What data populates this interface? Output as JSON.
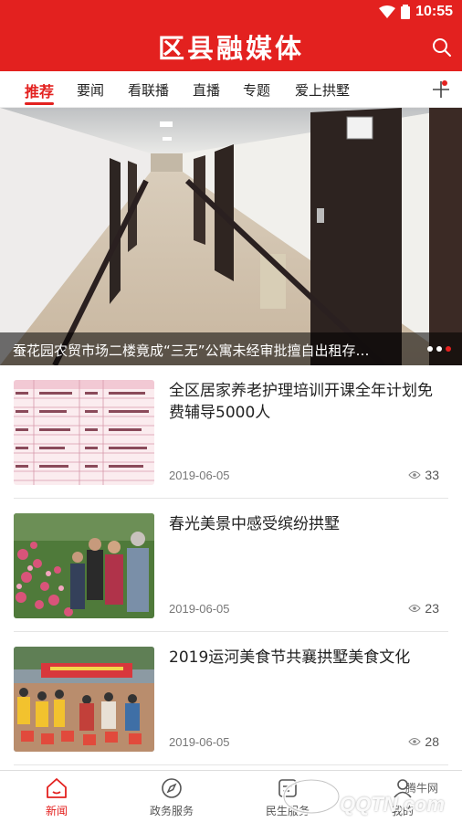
{
  "status_bar": {
    "time": "10:55"
  },
  "header": {
    "title": "区县融媒体"
  },
  "tabs": [
    {
      "label": "推荐"
    },
    {
      "label": "要闻"
    },
    {
      "label": "看联播"
    },
    {
      "label": "直播"
    },
    {
      "label": "专题"
    },
    {
      "label": "爱上拱墅"
    }
  ],
  "banner": {
    "caption": "蚕花园农贸市场二楼竟成“三无”公寓未经审批擅自出租存…",
    "active_slide": 3,
    "slide_count": 3
  },
  "news": [
    {
      "title": "全区居家养老护理培训开课全年计划免费辅导5000人",
      "date": "2019-06-05",
      "views": "33"
    },
    {
      "title": "春光美景中感受缤纷拱墅",
      "date": "2019-06-05",
      "views": "23"
    },
    {
      "title": "2019运河美食节共襄拱墅美食文化",
      "date": "2019-06-05",
      "views": "28"
    }
  ],
  "bottom_nav": [
    {
      "label": "新闻",
      "icon": "home-icon"
    },
    {
      "label": "政务服务",
      "icon": "compass-icon"
    },
    {
      "label": "民生服务",
      "icon": "service-icon"
    },
    {
      "label": "我的",
      "icon": "user-icon"
    }
  ],
  "watermark": {
    "line1": "腾牛网",
    "line2": "QQTN.com"
  },
  "colors": {
    "brand_red": "#e3211f"
  }
}
